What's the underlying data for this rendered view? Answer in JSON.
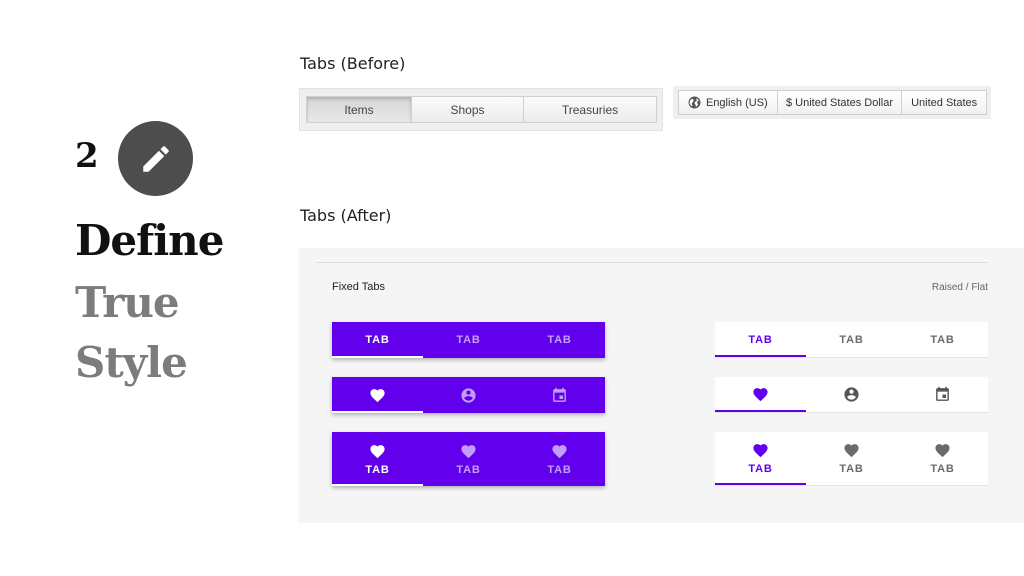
{
  "step": {
    "number": "2",
    "icon": "pencil-icon"
  },
  "headline": {
    "line1": "Define",
    "line2": "True",
    "line3": "Style"
  },
  "before": {
    "title": "Tabs (Before)",
    "tabs": [
      {
        "label": "Items",
        "active": true
      },
      {
        "label": "Shops",
        "active": false
      },
      {
        "label": "Treasuries",
        "active": false
      }
    ],
    "locale": {
      "language": "English (US)",
      "currency": "$ United States Dollar",
      "region": "United States",
      "icon": "globe-icon"
    }
  },
  "after": {
    "title": "Tabs (After)",
    "panel_title": "Fixed Tabs",
    "panel_meta": "Raised / Flat",
    "tab_label": "TAB",
    "icons": [
      "heart-icon",
      "account-circle-icon",
      "calendar-icon"
    ],
    "colors": {
      "primary": "#6200ee",
      "inactive": "#6b6b6b",
      "panel_bg": "#f5f5f5"
    }
  }
}
